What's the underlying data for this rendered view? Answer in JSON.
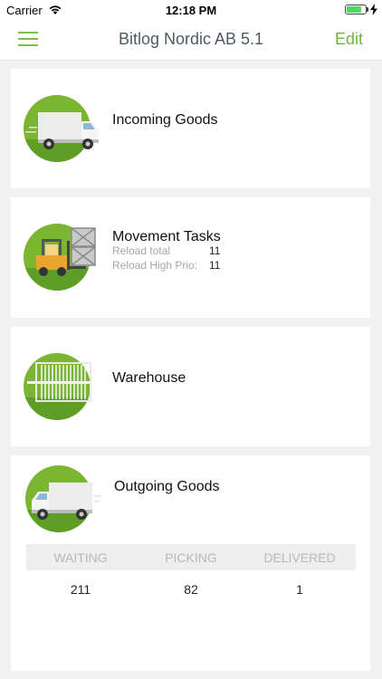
{
  "status_bar": {
    "carrier": "Carrier",
    "time": "12:18 PM",
    "battery_level": 0.8,
    "battery_color": "#4cd964"
  },
  "nav": {
    "title": "Bitlog Nordic AB 5.1",
    "edit_label": "Edit",
    "menu_icon": "hamburger-menu-icon",
    "accent_color": "#6cb33f"
  },
  "cards": {
    "incoming": {
      "title": "Incoming Goods",
      "icon": "delivery-truck-icon"
    },
    "movement": {
      "title": "Movement Tasks",
      "icon": "forklift-icon",
      "rows": [
        {
          "label": "Reload total",
          "value": "11"
        },
        {
          "label": "Reload High Prio:",
          "value": "11"
        }
      ]
    },
    "warehouse": {
      "title": "Warehouse",
      "icon": "warehouse-gate-icon"
    },
    "outgoing": {
      "title": "Outgoing Goods",
      "icon": "delivery-truck-icon",
      "stats": {
        "headers": [
          "WAITING",
          "PICKING",
          "DELIVERED"
        ],
        "values": [
          "211",
          "82",
          "1"
        ]
      }
    }
  }
}
